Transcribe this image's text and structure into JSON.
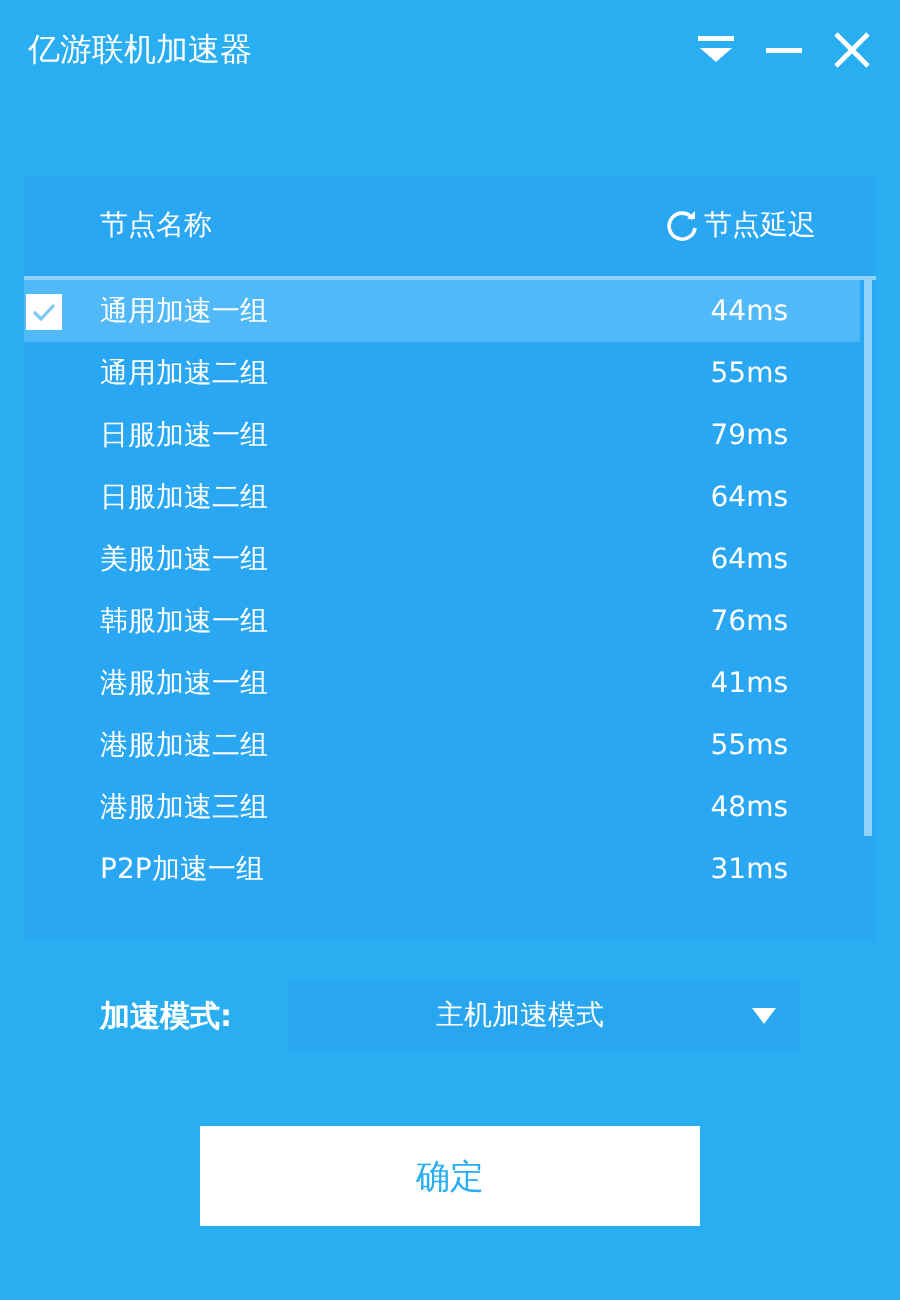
{
  "window": {
    "title": "亿游联机加速器"
  },
  "table": {
    "columns": [
      "节点名称",
      "节点延迟"
    ],
    "rows": [
      {
        "name": "通用加速一组",
        "latency": "44ms",
        "selected": true
      },
      {
        "name": "通用加速二组",
        "latency": "55ms",
        "selected": false
      },
      {
        "name": "日服加速一组",
        "latency": "79ms",
        "selected": false
      },
      {
        "name": "日服加速二组",
        "latency": "64ms",
        "selected": false
      },
      {
        "name": "美服加速一组",
        "latency": "64ms",
        "selected": false
      },
      {
        "name": "韩服加速一组",
        "latency": "76ms",
        "selected": false
      },
      {
        "name": "港服加速一组",
        "latency": "41ms",
        "selected": false
      },
      {
        "name": "港服加速二组",
        "latency": "55ms",
        "selected": false
      },
      {
        "name": "港服加速三组",
        "latency": "48ms",
        "selected": false
      },
      {
        "name": "P2P加速一组",
        "latency": "31ms",
        "selected": false
      }
    ]
  },
  "mode": {
    "label": "加速模式:",
    "value": "主机加速模式"
  },
  "confirm_button": "确定"
}
